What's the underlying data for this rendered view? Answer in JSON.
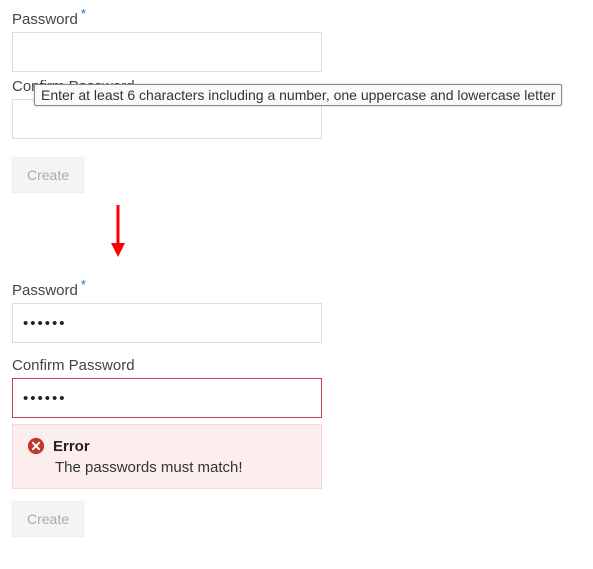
{
  "labels": {
    "password": "Password",
    "confirm_password": "Confirm Password",
    "required_mark": "*"
  },
  "tooltip": {
    "password_hint": "Enter at least 6 characters including a number, one uppercase and lowercase letter"
  },
  "buttons": {
    "create": "Create"
  },
  "state2": {
    "password_value": "••••••",
    "confirm_value": "••••••"
  },
  "error": {
    "title": "Error",
    "message": "The passwords must match!"
  },
  "colors": {
    "required": "#2a6ebb",
    "error_border": "#c1434a",
    "error_bg": "#fdeeee",
    "error_icon": "#c0392b",
    "arrow": "#ff0000"
  }
}
